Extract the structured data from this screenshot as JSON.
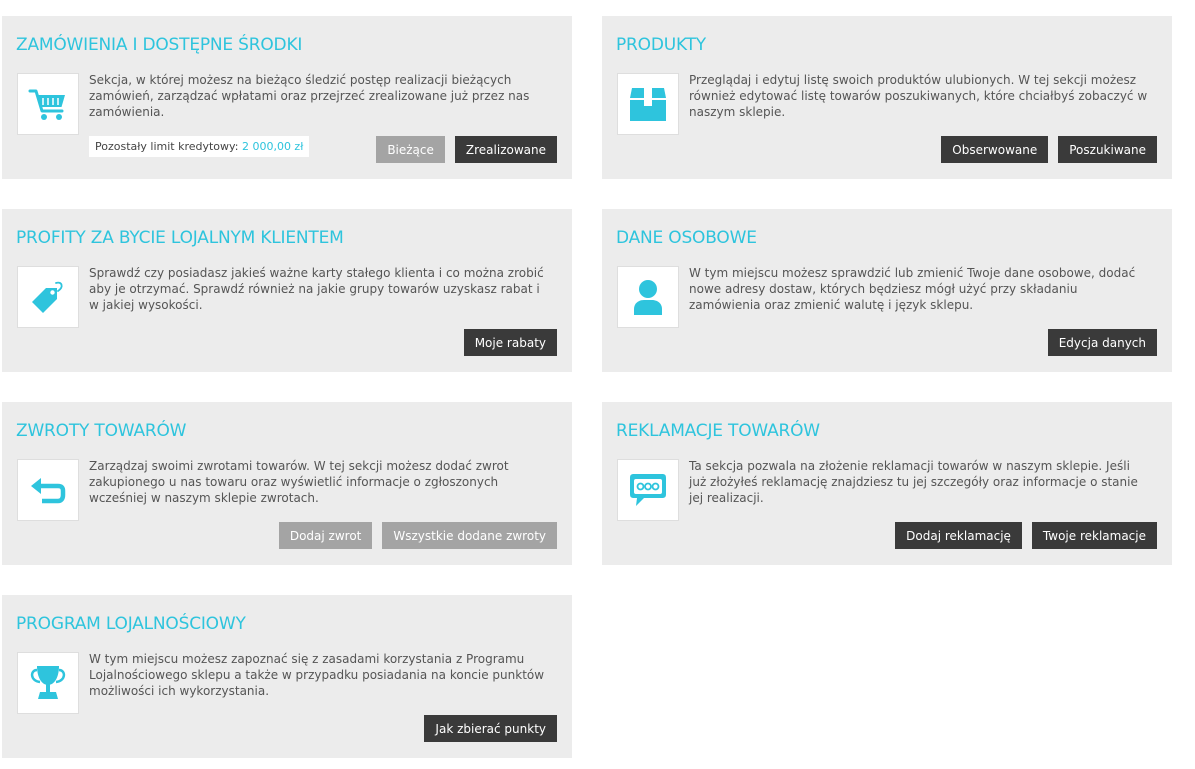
{
  "colors": {
    "accent": "#2ec4dd",
    "card_bg": "#ececec",
    "button_dark": "#3a3a3a",
    "button_light": "#a4a4a4"
  },
  "cards": {
    "orders": {
      "title": "ZAMÓWIENIA I DOSTĘPNE ŚRODKI",
      "icon": "shopping-cart-icon",
      "description": "Sekcja, w której możesz na bieżąco śledzić postęp realizacji bieżących zamówień, zarządzać wpłatami oraz przejrzeć zrealizowane już przez nas zamówienia.",
      "credit_label": "Pozostały limit kredytowy:",
      "credit_value": "2 000,00 zł",
      "buttons": [
        "Bieżące",
        "Zrealizowane"
      ]
    },
    "products": {
      "title": "PRODUKTY",
      "icon": "box-icon",
      "description": "Przeglądaj i edytuj listę swoich produktów ulubionych. W tej sekcji możesz również edytować listę towarów poszukiwanych, które chciałbyś zobaczyć w naszym sklepie.",
      "buttons": [
        "Obserwowane",
        "Poszukiwane"
      ]
    },
    "loyalty_benefits": {
      "title": "PROFITY ZA BYCIE LOJALNYM KLIENTEM",
      "icon": "price-tag-icon",
      "description": "Sprawdź czy posiadasz jakieś ważne karty stałego klienta i co można zrobić aby je otrzymać. Sprawdź również na jakie grupy towarów uzyskasz rabat i w jakiej wysokości.",
      "buttons": [
        "Moje rabaty"
      ]
    },
    "personal_data": {
      "title": "DANE OSOBOWE",
      "icon": "user-icon",
      "description": "W tym miejscu możesz sprawdzić lub zmienić Twoje dane osobowe, dodać nowe adresy dostaw, których będziesz mógł użyć przy składaniu zamówienia oraz zmienić walutę i język sklepu.",
      "buttons": [
        "Edycja danych"
      ]
    },
    "returns": {
      "title": "ZWROTY TOWARÓW",
      "icon": "return-arrow-icon",
      "description": "Zarządzaj swoimi zwrotami towarów. W tej sekcji możesz dodać zwrot zakupionego u nas towaru oraz wyświetlić informacje o zgłoszonych wcześniej w naszym sklepie zwrotach.",
      "buttons": [
        "Dodaj zwrot",
        "Wszystkie dodane zwroty"
      ]
    },
    "complaints": {
      "title": "REKLAMACJE TOWARÓW",
      "icon": "chat-bubble-icon",
      "description": "Ta sekcja pozwala na złożenie reklamacji towarów w naszym sklepie. Jeśli już złożyłeś reklamację znajdziesz tu jej szczegóły oraz informacje o stanie jej realizacji.",
      "buttons": [
        "Dodaj reklamację",
        "Twoje reklamacje"
      ]
    },
    "loyalty_program": {
      "title": "PROGRAM LOJALNOŚCIOWY",
      "icon": "trophy-icon",
      "description": "W tym miejscu możesz zapoznać się z zasadami korzystania z Programu Lojalnościowego sklepu a także w przypadku posiadania na koncie punktów możliwości ich wykorzystania.",
      "buttons": [
        "Jak zbierać punkty"
      ]
    }
  }
}
